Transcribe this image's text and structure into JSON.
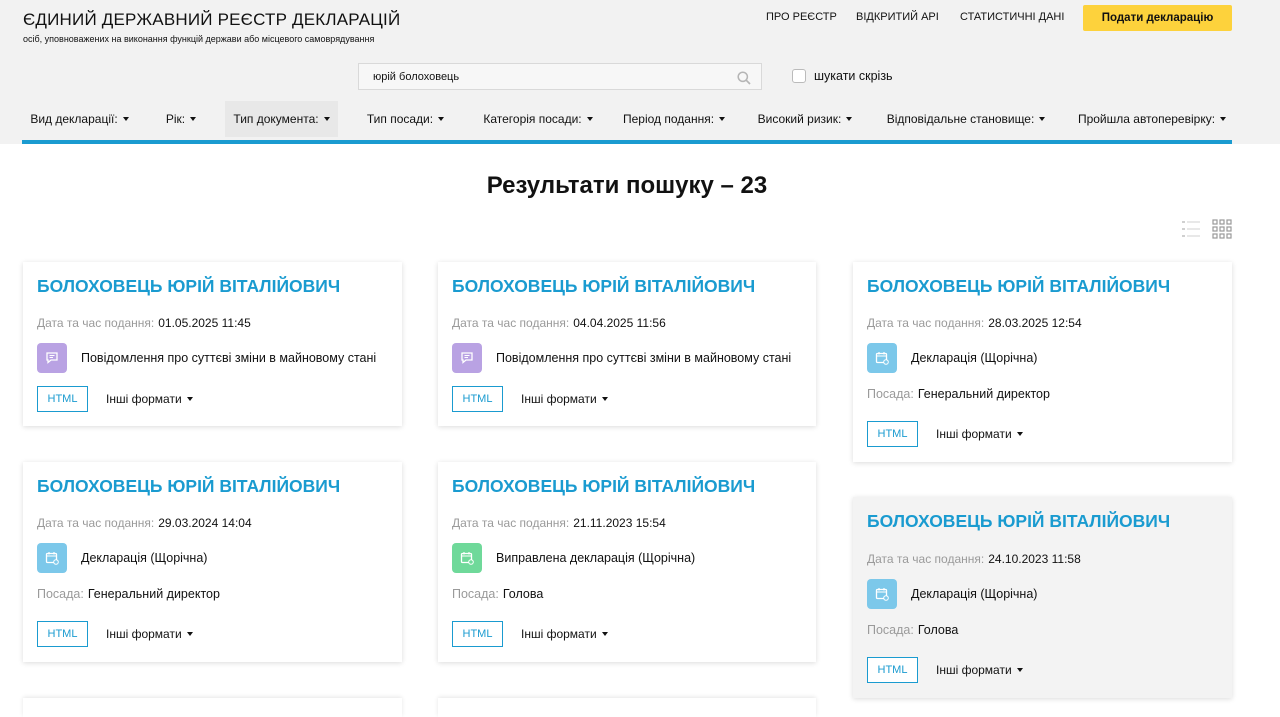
{
  "header": {
    "title": "ЄДИНИЙ ДЕРЖАВНИЙ РЕЄСТР ДЕКЛАРАЦІЙ",
    "subtitle": "осіб, уповноважених на виконання функцій держави або місцевого самоврядування",
    "nav": [
      "ПРО РЕЄСТР",
      "ВІДКРИТИЙ API",
      "СТАТИСТИЧНІ ДАНІ"
    ],
    "submit_label": "Подати декларацію"
  },
  "search": {
    "value": "юрій болоховець",
    "everywhere_label": "шукати скрізь"
  },
  "filters": [
    {
      "label": "Вид декларації:"
    },
    {
      "label": "Рік:"
    },
    {
      "label": "Тип документа:"
    },
    {
      "label": "Тип посади:"
    },
    {
      "label": "Категорія посади:"
    },
    {
      "label": "Період подання:"
    },
    {
      "label": "Високий ризик:"
    },
    {
      "label": "Відповідальне становище:"
    },
    {
      "label": "Пройшла автоперевірку:"
    }
  ],
  "results": {
    "title": "Результати пошуку – 23"
  },
  "card_labels": {
    "date_label": "Дата та час подання:",
    "position_label": "Посада:",
    "html_label": "HTML",
    "formats_label": "Інші формати"
  },
  "colors": {
    "accent": "#1a9bd0",
    "submit": "#fdd23c",
    "badge_change": "#b9a2e3",
    "badge_annual": "#7cc8ea",
    "badge_corrected": "#6fd99a"
  },
  "cards": [
    {
      "name": "БОЛОХОВЕЦЬ ЮРІЙ ВІТАЛІЙОВИЧ",
      "date": "01.05.2025 11:45",
      "type": "Повідомлення про суттєві зміни в майновому стані",
      "icon": "message-icon",
      "position": ""
    },
    {
      "name": "БОЛОХОВЕЦЬ ЮРІЙ ВІТАЛІЙОВИЧ",
      "date": "04.04.2025 11:56",
      "type": "Повідомлення про суттєві зміни в майновому стані",
      "icon": "message-icon",
      "position": ""
    },
    {
      "name": "БОЛОХОВЕЦЬ ЮРІЙ ВІТАЛІЙОВИЧ",
      "date": "28.03.2025 12:54",
      "type": "Декларація (Щорічна)",
      "icon": "calendar-icon",
      "position": "Генеральний директор"
    },
    {
      "name": "БОЛОХОВЕЦЬ ЮРІЙ ВІТАЛІЙОВИЧ",
      "date": "29.03.2024 14:04",
      "type": "Декларація (Щорічна)",
      "icon": "calendar-icon",
      "position": "Генеральний директор"
    },
    {
      "name": "БОЛОХОВЕЦЬ ЮРІЙ ВІТАЛІЙОВИЧ",
      "date": "21.11.2023 15:54",
      "type": "Виправлена декларація (Щорічна)",
      "icon": "calendar-icon",
      "position": "Голова"
    },
    {
      "name": "БОЛОХОВЕЦЬ ЮРІЙ ВІТАЛІЙОВИЧ",
      "date": "24.10.2023 11:58",
      "type": "Декларація (Щорічна)",
      "icon": "calendar-icon",
      "position": "Голова"
    }
  ]
}
